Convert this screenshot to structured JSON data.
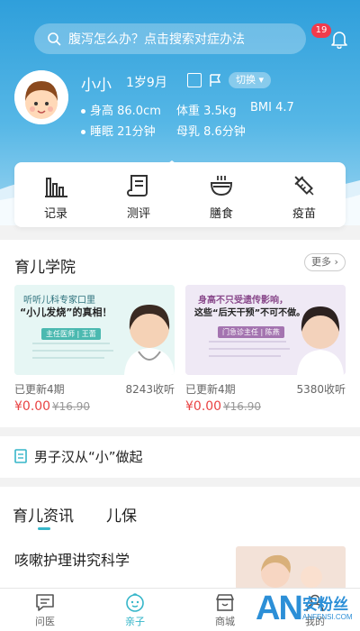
{
  "search": {
    "placeholder_text": "腹泻怎么办？点击搜索对症办法",
    "badge": "19"
  },
  "profile": {
    "name": "小小",
    "age": "1岁9月",
    "switch_label": "切换",
    "height": "身高 86.0cm",
    "weight": "体重 3.5kg",
    "bmi": "BMI 4.7",
    "sleep": "睡眠 21分钟",
    "milk": "母乳 8.6分钟"
  },
  "quick_actions": [
    {
      "label": "记录",
      "icon": "bar-chart-icon"
    },
    {
      "label": "测评",
      "icon": "scroll-icon"
    },
    {
      "label": "膳食",
      "icon": "bowl-icon"
    },
    {
      "label": "疫苗",
      "icon": "syringe-icon"
    }
  ],
  "academy": {
    "title": "育儿学院",
    "more": "更多",
    "courses": [
      {
        "headline": "听听儿科专家口里",
        "headline2": "“小儿发烧”的真相！",
        "doctor_title": "主任医师 | 王蕾",
        "updated": "已更新4期",
        "views": "8243收听",
        "price": "¥0.00",
        "old_price": "¥16.90"
      },
      {
        "headline": "身高不只受遗传影响，",
        "headline2": "这些“后天干预”不可不做。",
        "doctor_title": "门急诊主任 | 陈燕",
        "updated": "已更新4期",
        "views": "5380收听",
        "price": "¥0.00",
        "old_price": "¥16.90"
      }
    ]
  },
  "article": {
    "title": "男子汉从“小”做起"
  },
  "tabs": [
    {
      "label": "育儿资讯",
      "active": true
    },
    {
      "label": "儿保",
      "active": false
    }
  ],
  "news": {
    "title": "咳嗽护理讲究科学"
  },
  "nav": [
    {
      "label": "问医",
      "icon": "chat-icon",
      "active": false
    },
    {
      "label": "亲子",
      "icon": "baby-face-icon",
      "active": true
    },
    {
      "label": "商城",
      "icon": "shop-icon",
      "active": false
    },
    {
      "label": "我的",
      "icon": "user-icon",
      "active": false
    }
  ],
  "watermark": {
    "big": "AN",
    "cn": "安粉丝",
    "en": "ANFENSI.COM"
  },
  "colors": {
    "primary": "#36b6c9",
    "header": "#2f9fdb",
    "price": "#e94343",
    "badge": "#f23b4c"
  }
}
